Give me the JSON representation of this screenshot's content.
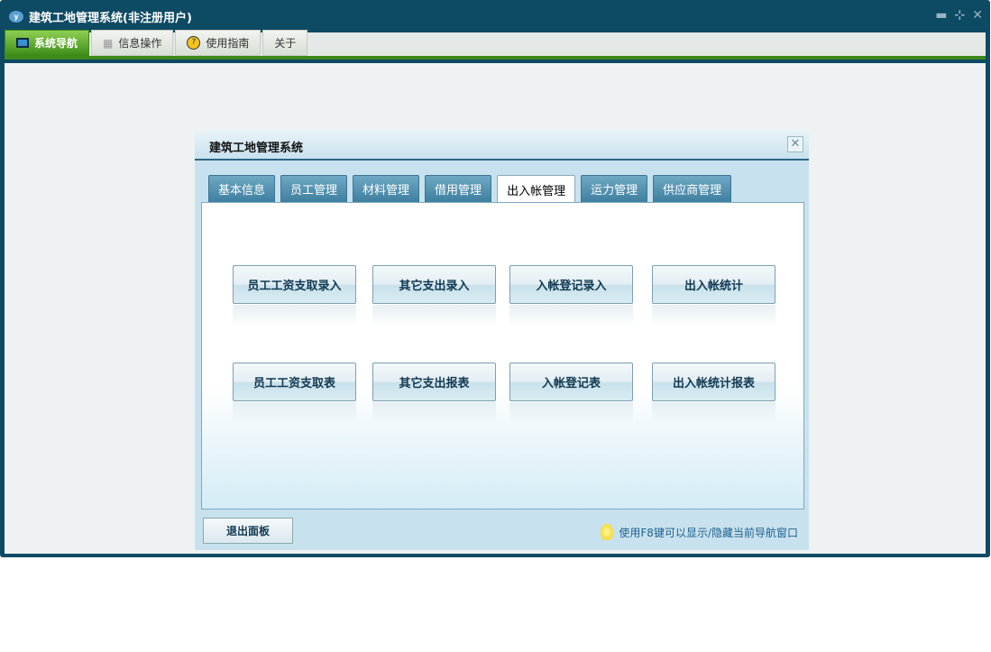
{
  "window": {
    "title": "建筑工地管理系统(非注册用户)"
  },
  "toolbar": [
    {
      "label": "系统导航",
      "icon": "monitor-icon"
    },
    {
      "label": "信息操作",
      "icon": "grid-icon"
    },
    {
      "label": "使用指南",
      "icon": "help-icon"
    },
    {
      "label": "关于"
    }
  ],
  "dialog": {
    "title": "建筑工地管理系统",
    "tabs": [
      "基本信息",
      "员工管理",
      "材料管理",
      "借用管理",
      "出入帐管理",
      "运力管理",
      "供应商管理"
    ],
    "active_tab": "出入帐管理",
    "buttons": [
      "员工工资支取录入",
      "其它支出录入",
      "入帐登记录入",
      "出入帐统计",
      "员工工资支取表",
      "其它支出报表",
      "入帐登记表",
      "出入帐统计报表"
    ],
    "exit_label": "退出面板",
    "hint": "使用F8键可以显示/隐藏当前导航窗口"
  }
}
